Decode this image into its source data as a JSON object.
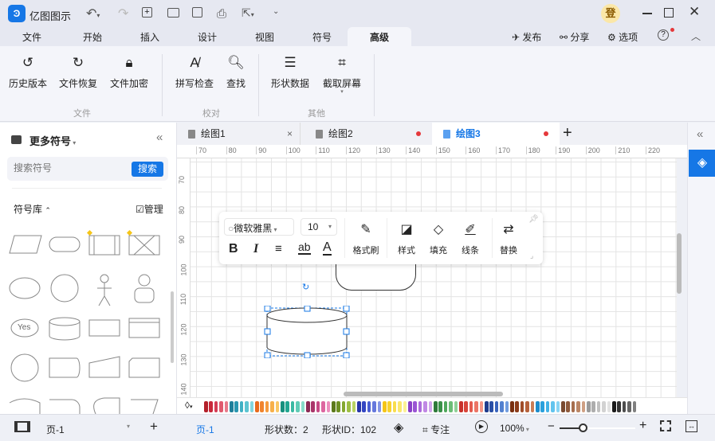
{
  "app": {
    "title": "亿图图示",
    "login_badge": "登"
  },
  "menu": [
    "文件",
    "开始",
    "插入",
    "设计",
    "视图",
    "符号",
    "高级"
  ],
  "menu_right": {
    "publish": "发布",
    "share": "分享",
    "options": "选项"
  },
  "ribbon": {
    "buttons": [
      {
        "label": "历史版本",
        "icon": "history-icon"
      },
      {
        "label": "文件恢复",
        "icon": "restore-icon"
      },
      {
        "label": "文件加密",
        "icon": "lock-icon"
      },
      {
        "label": "拼写检查",
        "icon": "spellcheck-icon"
      },
      {
        "label": "查找",
        "icon": "find-icon"
      },
      {
        "label": "形状数据",
        "icon": "shape-data-icon"
      },
      {
        "label": "截取屏幕",
        "icon": "crop-icon"
      }
    ],
    "groups": [
      "文件",
      "校对",
      "其他"
    ]
  },
  "left_panel": {
    "title": "更多符号",
    "search_placeholder": "搜索符号",
    "search_button": "搜索",
    "library_label": "符号库",
    "manage_label": "管理",
    "yes_label": "Yes"
  },
  "tabs": [
    {
      "label": "绘图1",
      "active": false
    },
    {
      "label": "绘图2",
      "active": false
    },
    {
      "label": "绘图3",
      "active": true
    }
  ],
  "ruler_top": [
    "70",
    "80",
    "90",
    "100",
    "110",
    "120",
    "130",
    "140",
    "150",
    "160",
    "170",
    "180",
    "190",
    "200",
    "210",
    "220"
  ],
  "ruler_left": [
    "70",
    "80",
    "90",
    "100",
    "110",
    "120",
    "130",
    "140"
  ],
  "float_toolbar": {
    "font": "微软雅黑",
    "size": "10",
    "format_painter": "格式刷",
    "style": "样式",
    "fill": "填充",
    "line": "线条",
    "replace": "替换",
    "bold": "B",
    "italic": "I",
    "ab": "ab",
    "A": "A"
  },
  "palette": [
    "#b3202a",
    "#c8283a",
    "#d43d55",
    "#e05a6e",
    "#e87a8a",
    "#1f7f9a",
    "#2a96b0",
    "#3fb0c4",
    "#5cc4d2",
    "#82d6df",
    "#e86a1c",
    "#f0842e",
    "#f59b3f",
    "#f7b04a",
    "#f9c765",
    "#18907e",
    "#22a691",
    "#3bb9a3",
    "#5fcbb6",
    "#88dbc9",
    "#8c2a55",
    "#a9366a",
    "#c64a85",
    "#dd66a0",
    "#ec8cbd",
    "#5c7a1c",
    "#6e9124",
    "#84a830",
    "#9dbe44",
    "#b8d363",
    "#2635a8",
    "#3446c2",
    "#4a5ed2",
    "#6678dc",
    "#8595e6",
    "#f5c518",
    "#f7d230",
    "#f9dd4d",
    "#fae76e",
    "#fcf195",
    "#8a40c8",
    "#9a55d4",
    "#ad6bdc",
    "#c088e4",
    "#d2a6ec",
    "#2e7a3a",
    "#3a9149",
    "#4fa75c",
    "#6bbd76",
    "#8fd097",
    "#c8302a",
    "#d8443a",
    "#e35a4e",
    "#ec7566",
    "#f39686",
    "#1e3c8c",
    "#2a4fa6",
    "#3a64bc",
    "#5280cf",
    "#729ddf",
    "#7a3010",
    "#8c3c1a",
    "#a04c28",
    "#b6623c",
    "#c97d56",
    "#1c8ccc",
    "#2aa0dc",
    "#42b2e6",
    "#62c4ee",
    "#88d4f4",
    "#7a4a30",
    "#8f5a3c",
    "#a66e4e",
    "#bb8666",
    "#cfa084",
    "#9a9a9a",
    "#adadad",
    "#c0c0c0",
    "#d2d2d2",
    "#e2e2e2",
    "#1a1a1a",
    "#333333",
    "#4d4d4d",
    "#666666",
    "#808080"
  ],
  "status": {
    "page_select": "页-1",
    "page_tab": "页-1",
    "shape_count": "形状数：2",
    "shape_id": "形状ID：102",
    "focus": "专注",
    "zoom": "100%",
    "zoom_fraction": 0.3
  },
  "colors": {
    "accent": "#1677e6",
    "modified_dot": "#e5383b"
  }
}
